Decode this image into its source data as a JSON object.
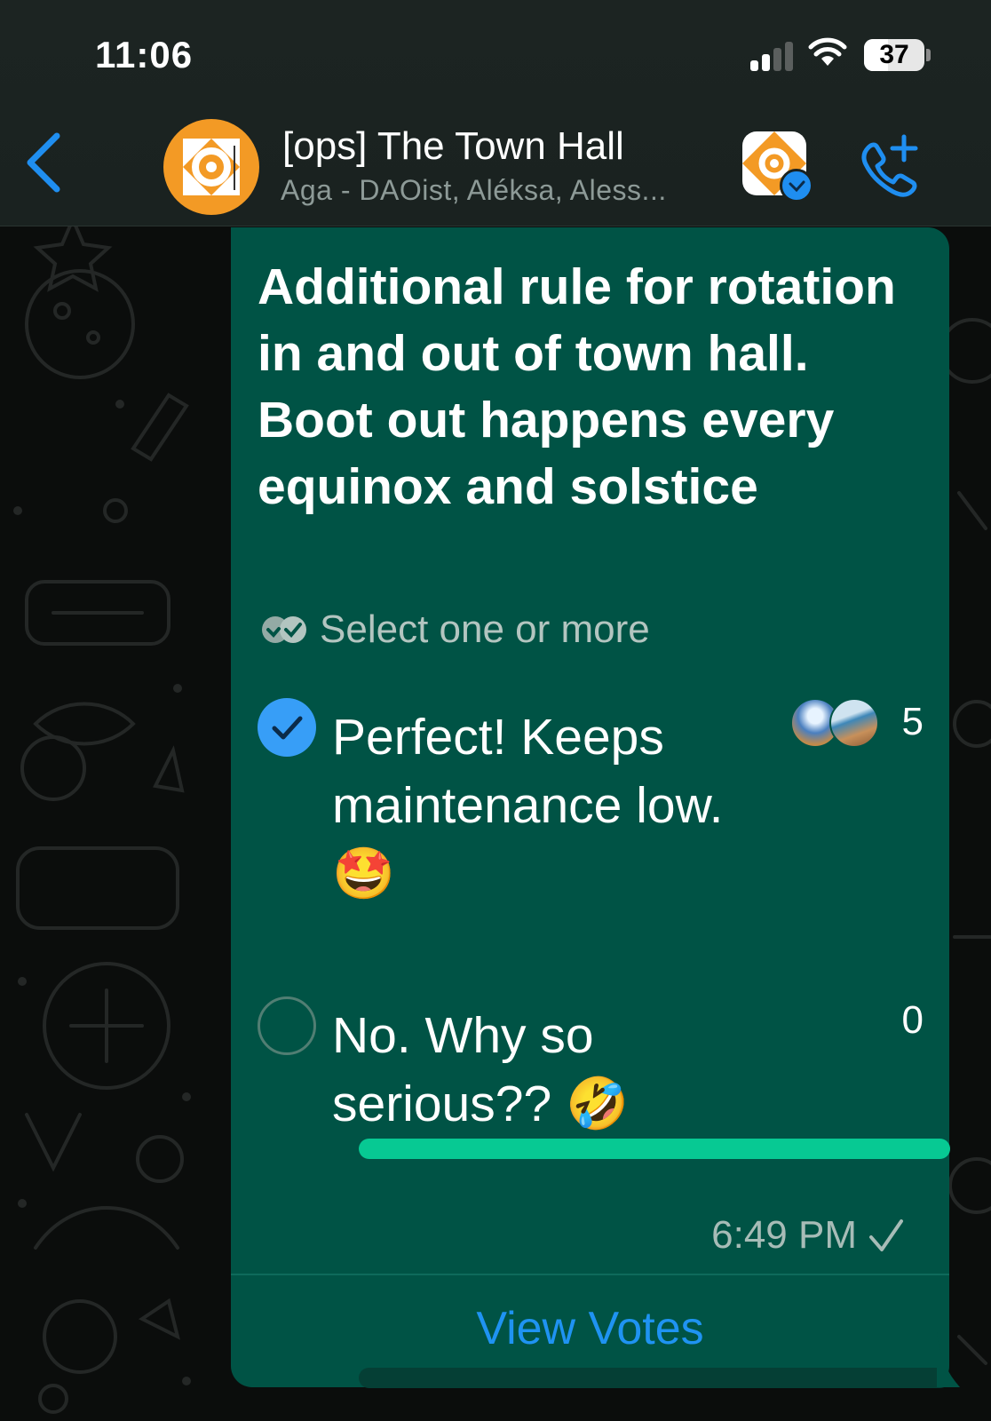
{
  "status_bar": {
    "time": "11:06",
    "battery": "37"
  },
  "header": {
    "title": "[ops] The Town Hall",
    "members": "Aga - DAOist, Aléksa, Aless..."
  },
  "poll": {
    "question": "Additional rule for rotation in and out of town hall. Boot out happens every equinox and solstice",
    "hint": "Select one or more",
    "options": [
      {
        "text": "Perfect! Keeps maintenance low. 🤩",
        "votes": "5",
        "selected": true,
        "fraction": 1.0
      },
      {
        "text": "No. Why so serious?? 🤣",
        "votes": "0",
        "selected": false,
        "fraction": 0.0
      }
    ],
    "timestamp": "6:49 PM",
    "view_votes": "View Votes"
  },
  "colors": {
    "bubble": "#005345",
    "accent_blue": "#1f93f2",
    "bar_fill": "#07c993",
    "avatar_orange": "#f39a25"
  },
  "icons": [
    "back-chevron-icon",
    "group-avatar",
    "community-icon",
    "verified-icon",
    "add-call-icon",
    "double-check-icon",
    "checkmark-icon",
    "read-tick-icon"
  ]
}
